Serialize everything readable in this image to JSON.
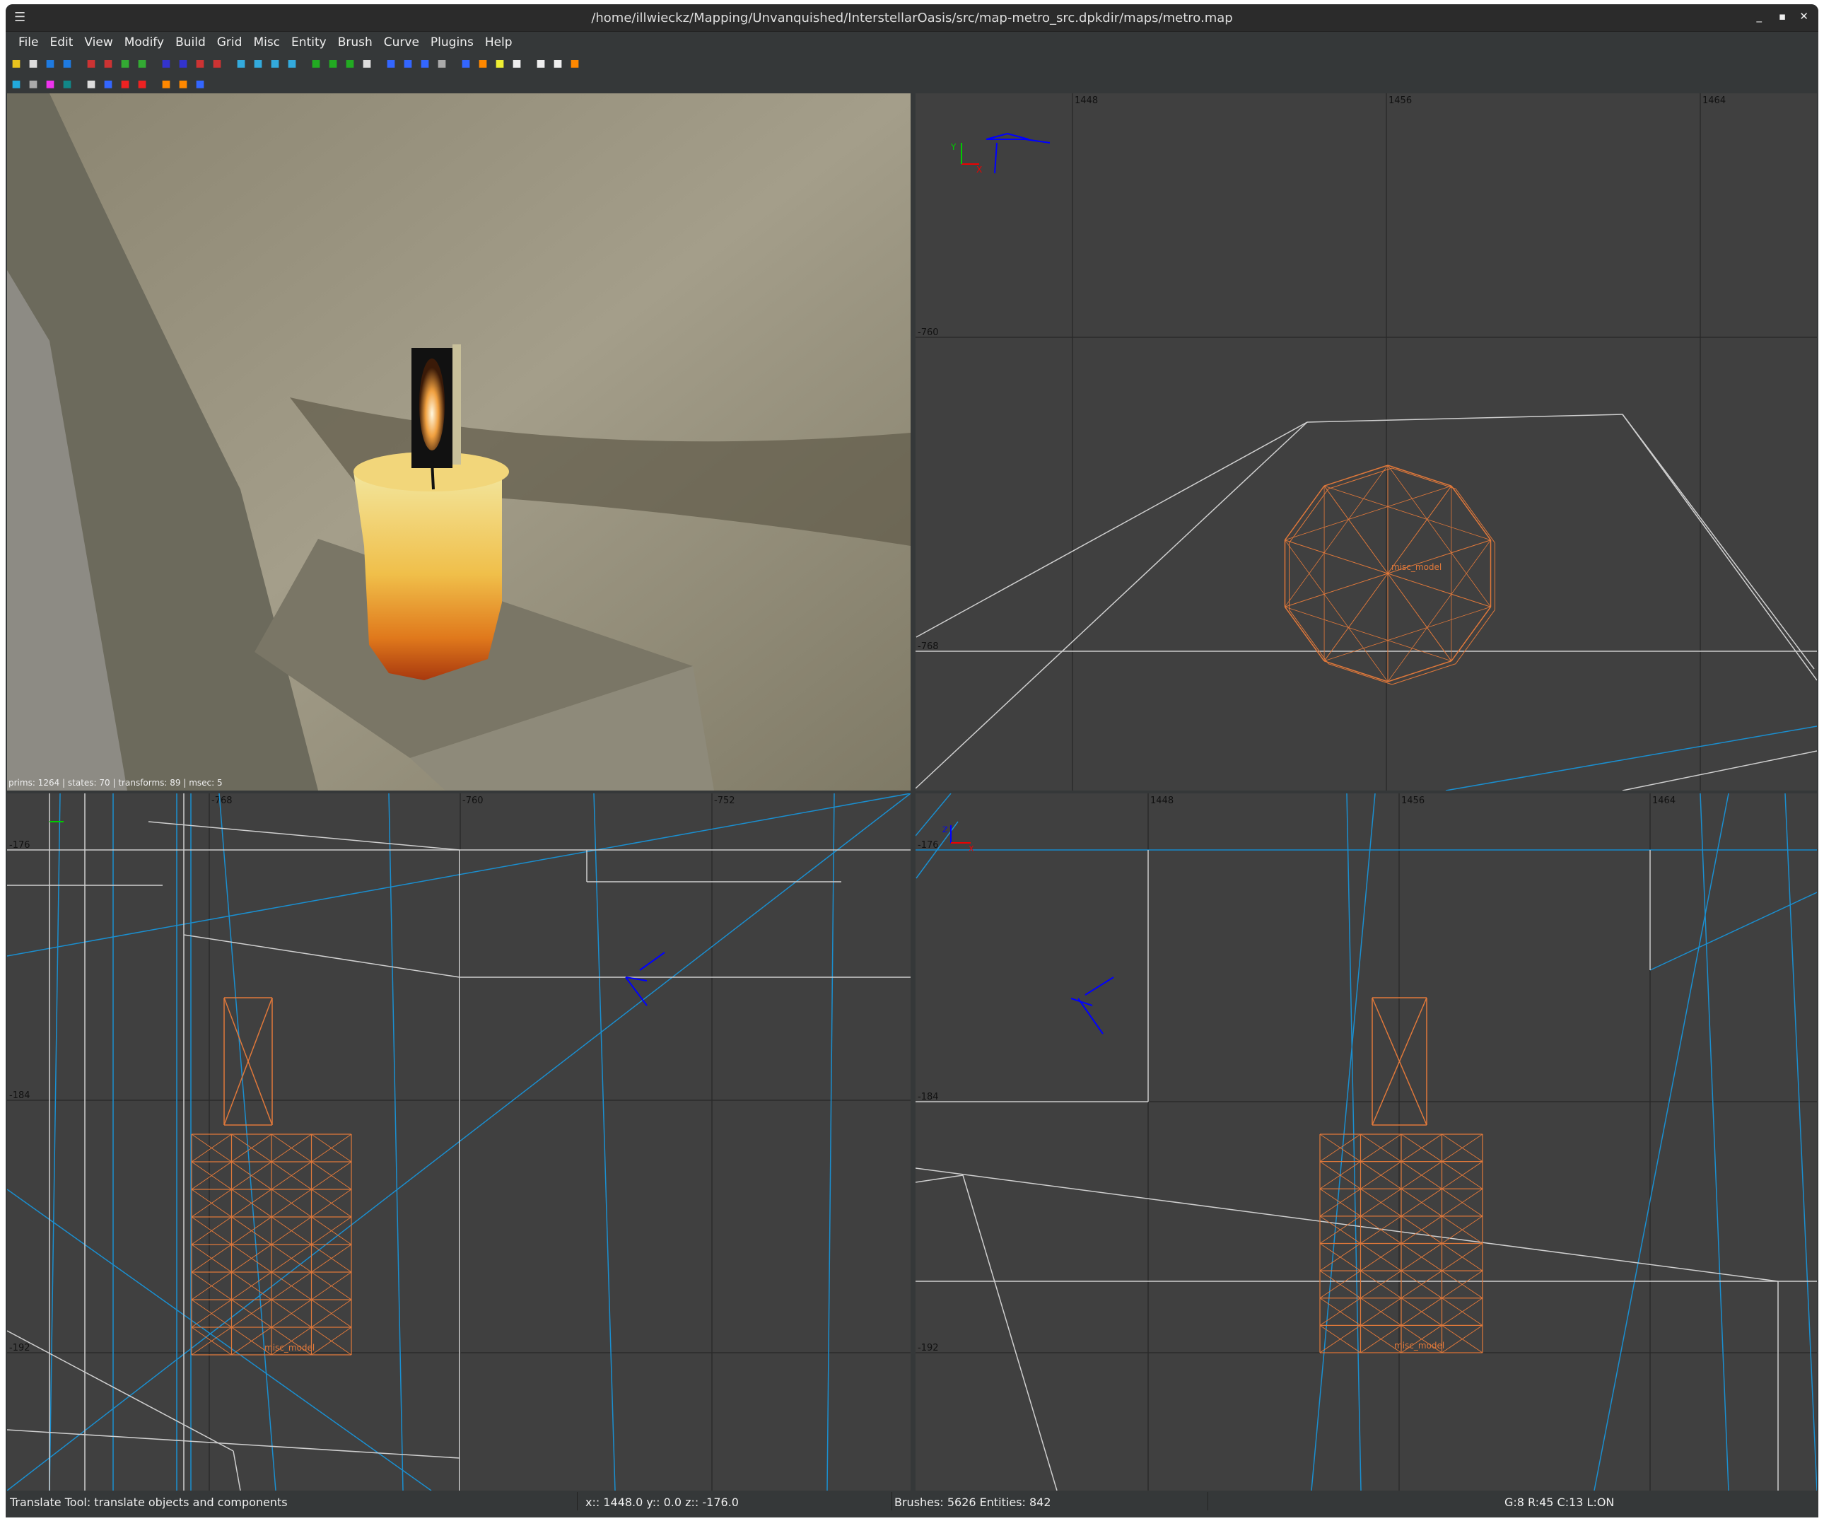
{
  "window": {
    "title": "/home/illwieckz/Mapping/Unvanquished/InterstellarOasis/src/map-metro_src.dpkdir/maps/metro.map",
    "menu_icon": "hamburger-icon",
    "controls": [
      "minimize-icon",
      "maximize-icon",
      "close-icon"
    ]
  },
  "menu": [
    "File",
    "Edit",
    "View",
    "Modify",
    "Build",
    "Grid",
    "Misc",
    "Entity",
    "Brush",
    "Curve",
    "Plugins",
    "Help"
  ],
  "toolbar_row1": [
    "open-icon",
    "save-icon",
    "undo-icon",
    "redo-icon",
    "flip-x-icon",
    "rotate-x-icon",
    "flip-y-icon",
    "rotate-y-icon",
    "flip-z-icon",
    "rotate-z-icon",
    "csg-hollow-icon",
    "csg-subtract-icon",
    "select-inside-icon",
    "select-touching-icon",
    "select-partial-icon",
    "select-complete-icon",
    "brush-prism-icon",
    "brush-cone-icon",
    "brush-sphere-icon",
    "camera-icon",
    "translate-icon",
    "rotate-icon",
    "scale-icon",
    "resize-icon",
    "clipper-icon",
    "entity-icon",
    "texture-lock-icon",
    "patch-inspector-icon",
    "surface-inspector-icon",
    "texture-browser-icon",
    "refresh-icon"
  ],
  "toolbar_row2": [
    "filter-icon",
    "circle-icon",
    "shader-icon",
    "tree-icon",
    "camera-view-icon",
    "entity-list-icon",
    "mirror-icon",
    "diamond-icon",
    "curve-icon",
    "arc-icon",
    "region-icon"
  ],
  "colors": {
    "wire_orange": "#e0783a",
    "brush_white": "#cfcfcf",
    "brush_blue": "#1a8fd0",
    "grid": "#2a2a2a"
  },
  "camera": {
    "stats": "prims: 1264 | states: 70 | transforms: 89 | msec: 5"
  },
  "view_top": {
    "x_ticks": [
      "1448",
      "1456",
      "1464"
    ],
    "y_ticks": [
      "-760",
      "-768"
    ],
    "axis_labels": [
      "Y",
      "X"
    ],
    "entity_label": "misc_model"
  },
  "view_side_left": {
    "x_ticks": [
      "-768",
      "-760",
      "-752"
    ],
    "y_ticks": [
      "-176",
      "-184",
      "-192"
    ],
    "entity_label": "misc_model"
  },
  "view_front": {
    "x_ticks": [
      "1448",
      "1456",
      "1464"
    ],
    "y_ticks": [
      "-176",
      "-184",
      "-192"
    ],
    "axis_labels": [
      "Z",
      "X"
    ],
    "entity_label": "misc_model"
  },
  "status": {
    "tool": "Translate Tool: translate objects and components",
    "coords": "x:: 1448.0  y::    0.0  z:: -176.0",
    "counts": "Brushes: 5626 Entities: 842",
    "grid": "G:8  R:45  C:13  L:ON"
  }
}
